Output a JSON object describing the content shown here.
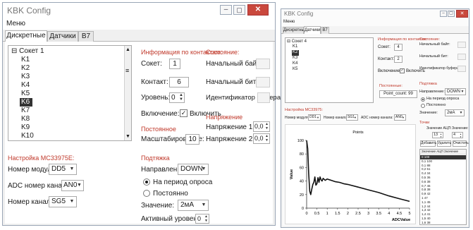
{
  "left": {
    "title": "KBK Config",
    "menu": "Меню",
    "tabs": [
      "Дискретные",
      "Датчики",
      "B7"
    ],
    "sockets": [
      "Сокет 1",
      "K1",
      "K2",
      "K3",
      "K4",
      "K5",
      "K6",
      "K7",
      "K8",
      "K9",
      "K10"
    ],
    "info_header": "Информация по контактам:",
    "socket_label": "Сокет:",
    "socket_value": "1",
    "contact_label": "Контакт:",
    "contact_value": "6",
    "level_label": "Уровень:",
    "level_value": "0",
    "enable_label": "Включение:",
    "enable_chk": "✓",
    "enable_text": "Включить",
    "const_header": "Постоянное",
    "scale_label": "Масштабирование:",
    "scale_value": "10",
    "state_header": "Состояние:",
    "start_byte": "Начальный байт:",
    "start_bit": "Начальный бит:",
    "buffer_id": "Идентификатор буфера:",
    "voltage_header": "Напряжение",
    "voltage1_label": "Напряжение 1:",
    "voltage1_value": "0,0",
    "voltage2_label": "Напряжение 2:",
    "voltage2_value": "0,0",
    "mc_header": "Настройка MC33975E:",
    "module_label": "Номер модуля:",
    "module_value": "DD5",
    "adc_label": "ADC номер канала:",
    "adc_value": "AN0",
    "channel_label": "Номер канала:",
    "channel_value": "SG5",
    "pull_header": "Подтяжка",
    "direction_label": "Направление:",
    "direction_value": "DOWN",
    "poll_text": "На период опроса",
    "const_text": "Постоянно",
    "value_label": "Значение:",
    "value_value": "2мА",
    "active_label": "Активный уровень:",
    "active_value": "0"
  },
  "right": {
    "title": "KBK Config",
    "menu": "Меню",
    "tabs": [
      "Дискретные",
      "Датчики",
      "B7"
    ],
    "tree": [
      "Сокет 4",
      "K1",
      "K2",
      "K3",
      "K4",
      "K5"
    ],
    "info_header": "Информация по контактам:",
    "socket_label": "Сокет:",
    "socket_value": "4",
    "contact_label": "Контакт:",
    "contact_value": "2",
    "enable_label": "Включение:",
    "enable_chk": "✓",
    "enable_text": "Включить",
    "const_header": "Постоянные:",
    "const_value": "Point_count: 99",
    "state_header": "Состояние:",
    "start_byte": "Начальный байт:",
    "start_bit": "Начальный бит:",
    "buffer_id": "Идентификатор буфера:",
    "pull_header": "Подтяжка",
    "direction_label": "Направление:",
    "direction_value": "DOWN",
    "poll_text": "На период опроса",
    "const_text": "Постоянно",
    "value_label": "Значение:",
    "value_value": "2мА",
    "mc_header": "Настройка MC33975:",
    "module_label": "Номер модуля:",
    "module_value": "DD1",
    "channel_label": "Номер канала:",
    "channel_value": "SG1",
    "adc_label": "ADC номер канала:",
    "adc_value": "AN0",
    "points_header": "Точки",
    "adc_point_label": "Значение АЦП:",
    "adc_point_value": "13",
    "val_point_label": "Значение:",
    "val_point_value": "4",
    "add_btn": "Добавить",
    "del_btn": "Удалить",
    "clear_btn": "Очистить",
    "table_header": "Значение АЦП  Значение",
    "table_rows": [
      "0  100",
      "0,1  100",
      "0,1  88",
      "0,2  51",
      "0,4  34",
      "0,5  36",
      "0,6  38",
      "0,7  46",
      "0,8  38",
      "0,9  42",
      "1  47",
      "1,1  45",
      "1,2  44",
      "1,3  42",
      "1,4  41",
      "1,5  40",
      "1,6  38"
    ]
  },
  "chart_data": {
    "type": "line",
    "title": "Points",
    "xlabel": "ADCValue",
    "ylabel": "Value",
    "xlim": [
      0,
      5
    ],
    "ylim": [
      0,
      100
    ],
    "xticks": [
      "0",
      "0.5",
      "1",
      "1.5",
      "2",
      "2.5",
      "3",
      "3.5",
      "4",
      "4.5",
      "5"
    ],
    "yticks": [
      "0",
      "20",
      "40",
      "60",
      "80",
      "100"
    ],
    "series": [
      {
        "x": [
          0,
          0.05,
          0.1,
          0.15,
          0.2,
          0.25,
          0.3,
          0.35,
          0.4,
          0.45,
          0.5,
          0.55,
          0.6,
          0.65,
          0.7,
          0.75,
          0.8,
          0.9,
          1.0,
          1.1,
          1.2,
          1.4,
          1.6,
          1.8,
          2.0,
          2.5,
          3.0,
          3.5,
          4.0,
          4.5,
          5.0
        ],
        "y": [
          100,
          88,
          51,
          25,
          20,
          28,
          35,
          38,
          46,
          34,
          36,
          45,
          38,
          46,
          42,
          40,
          44,
          41,
          43,
          42,
          41,
          39,
          38,
          36,
          35,
          31,
          27,
          23,
          18,
          14,
          10
        ]
      }
    ],
    "line_color": "#111111"
  }
}
